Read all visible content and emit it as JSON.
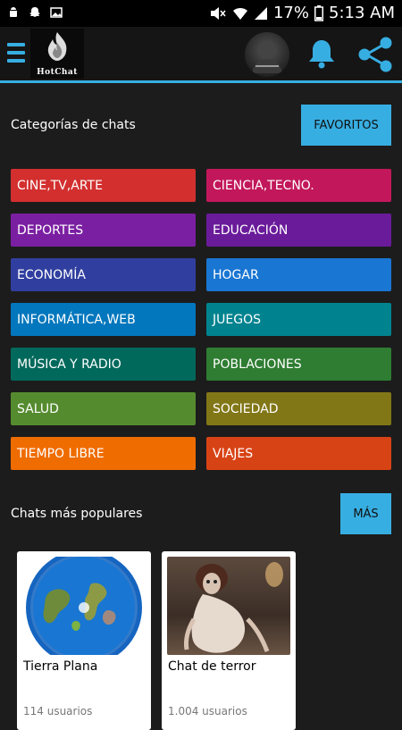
{
  "status_bar": {
    "battery": "17%",
    "time": "5:13 AM"
  },
  "app_bar": {
    "logo_text": "HotChat"
  },
  "categories_section": {
    "title": "Categorías de chats",
    "favorites_label": "FAVORITOS",
    "items": [
      {
        "label": "CINE,TV,ARTE",
        "color": "#d32f2f"
      },
      {
        "label": "CIENCIA,TECNO.",
        "color": "#c2185b"
      },
      {
        "label": "DEPORTES",
        "color": "#7b1fa2"
      },
      {
        "label": "EDUCACIÓN",
        "color": "#6a1b9a"
      },
      {
        "label": "ECONOMÍA",
        "color": "#303f9f"
      },
      {
        "label": "HOGAR",
        "color": "#1976d2"
      },
      {
        "label": "INFORMÁTICA,WEB",
        "color": "#0277bd"
      },
      {
        "label": "JUEGOS",
        "color": "#00838f"
      },
      {
        "label": "MÚSICA Y RADIO",
        "color": "#00695c"
      },
      {
        "label": "POBLACIONES",
        "color": "#2e7d32"
      },
      {
        "label": "SALUD",
        "color": "#558b2f"
      },
      {
        "label": "SOCIEDAD",
        "color": "#827717"
      },
      {
        "label": "TIEMPO LIBRE",
        "color": "#ef6c00"
      },
      {
        "label": "VIAJES",
        "color": "#d84315"
      }
    ]
  },
  "popular_section": {
    "title": "Chats más populares",
    "more_label": "MÁS",
    "cards": [
      {
        "title": "Tierra Plana",
        "users": "114 usuarios"
      },
      {
        "title": "Chat de terror",
        "users": "1.004 usuarios"
      }
    ]
  },
  "colors": {
    "accent": "#37aee2",
    "background": "#1c1c1c"
  }
}
